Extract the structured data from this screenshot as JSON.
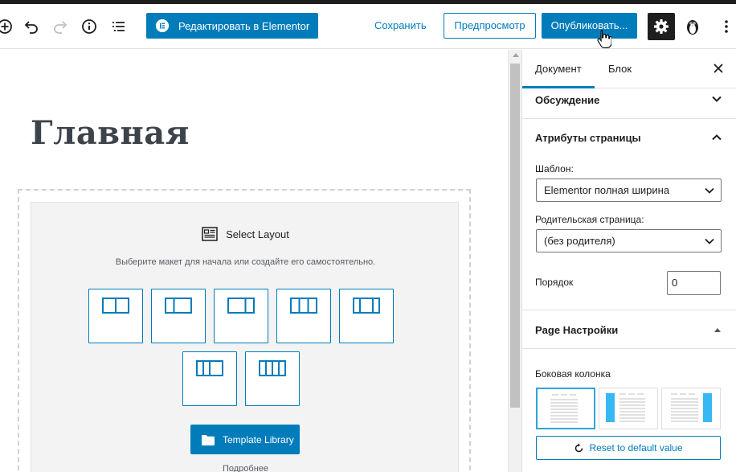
{
  "toolbar": {
    "add_icon": "plus-circle-icon",
    "undo_icon": "undo-icon",
    "redo_icon": "redo-icon",
    "info_icon": "info-icon",
    "list_icon": "list-view-icon",
    "elementor_label": "Редактировать в Elementor",
    "save_label": "Сохранить",
    "preview_label": "Предпросмотр",
    "publish_label": "Опубликовать...",
    "settings_icon": "gear-icon",
    "plugin_icon": "penguin-icon",
    "more_icon": "more-vertical-icon"
  },
  "editor": {
    "page_title": "Главная",
    "select_layout_title": "Select Layout",
    "select_layout_subtitle": "Выберите макет для начала или создайте его самостоятельно.",
    "layouts": [
      {
        "name": "1/2 + 1/2",
        "columns": [
          1,
          1
        ]
      },
      {
        "name": "1/3 + 2/3",
        "columns": [
          1,
          2
        ]
      },
      {
        "name": "2/3 + 1/3",
        "columns": [
          2,
          1
        ]
      },
      {
        "name": "1/3 + 1/3 + 1/3",
        "columns": [
          1,
          1,
          1
        ]
      },
      {
        "name": "1/4 + 1/2 + 1/4",
        "columns": [
          1,
          2,
          1
        ]
      },
      {
        "name": "1/4 + 1/4 + 1/2",
        "columns": [
          1,
          1,
          2
        ]
      },
      {
        "name": "1/4 x 4",
        "columns": [
          1,
          1,
          1,
          1
        ]
      }
    ],
    "template_library_label": "Template Library",
    "more_text": "Подробнее"
  },
  "sidebar": {
    "tabs": [
      "Документ",
      "Блок"
    ],
    "close_icon": "close-icon",
    "discussion_title": "Обсуждение",
    "page_attributes_title": "Атрибуты страницы",
    "template_label": "Шаблон:",
    "template_value": "Elementor полная ширина",
    "parent_label": "Родительская страница:",
    "parent_value": "(без родителя)",
    "order_label": "Порядок",
    "order_value": "0",
    "page_settings_title": "Page Настройки",
    "sidebar_label": "Боковая колонка",
    "sidebar_options": [
      "no-sidebar",
      "left-sidebar",
      "right-sidebar"
    ],
    "reset_label": "Reset to default value"
  },
  "colors": {
    "accent": "#007cba",
    "dark": "#1e1e1e",
    "sidebar_highlight": "#2ba5d8"
  }
}
